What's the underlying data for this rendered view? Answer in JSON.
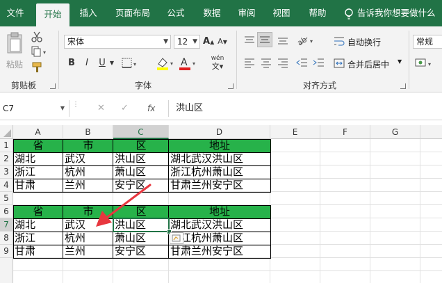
{
  "ribbon_tabs": [
    "文件",
    "开始",
    "插入",
    "页面布局",
    "公式",
    "数据",
    "审阅",
    "视图",
    "帮助"
  ],
  "active_tab": "开始",
  "tell_me": "告诉我你想要做什么",
  "clipboard": {
    "paste_label": "粘贴",
    "group_label": "剪贴板"
  },
  "font": {
    "name": "宋体",
    "size": "12",
    "bold": "B",
    "italic": "I",
    "underline": "U",
    "phonetic": "wén",
    "group_label": "字体"
  },
  "alignment": {
    "wrap_text": "自动换行",
    "merge_center": "合并后居中",
    "group_label": "对齐方式"
  },
  "number": {
    "format": "常规"
  },
  "formula_bar": {
    "name_box": "C7",
    "cancel": "✕",
    "enter": "✓",
    "fx": "fx",
    "content": "洪山区"
  },
  "colors": {
    "accent": "#217346",
    "header_fill": "#27b24a",
    "arrow": "#e8373f"
  },
  "columns": [
    "A",
    "B",
    "C",
    "D",
    "E",
    "F",
    "G"
  ],
  "rows": [
    "1",
    "2",
    "3",
    "4",
    "5",
    "6",
    "7",
    "8",
    "9"
  ],
  "selected_cell": "C7",
  "table1": {
    "headers": [
      "省",
      "市",
      "区",
      "地址"
    ],
    "rows": [
      [
        "湖北",
        "武汉",
        "洪山区",
        "湖北武汉洪山区"
      ],
      [
        "浙江",
        "杭州",
        "萧山区",
        "浙江杭州萧山区"
      ],
      [
        "甘肃",
        "兰州",
        "安宁区",
        "甘肃兰州安宁区"
      ]
    ]
  },
  "table2": {
    "headers": [
      "省",
      "市",
      "区",
      "地址"
    ],
    "rows": [
      [
        "湖北",
        "武汉",
        "洪山区",
        "湖北武汉洪山区"
      ],
      [
        "浙江",
        "杭州",
        "萧山区",
        "浙江杭州萧山区"
      ],
      [
        "甘肃",
        "兰州",
        "安宁区",
        "甘肃兰州安宁区"
      ]
    ]
  }
}
